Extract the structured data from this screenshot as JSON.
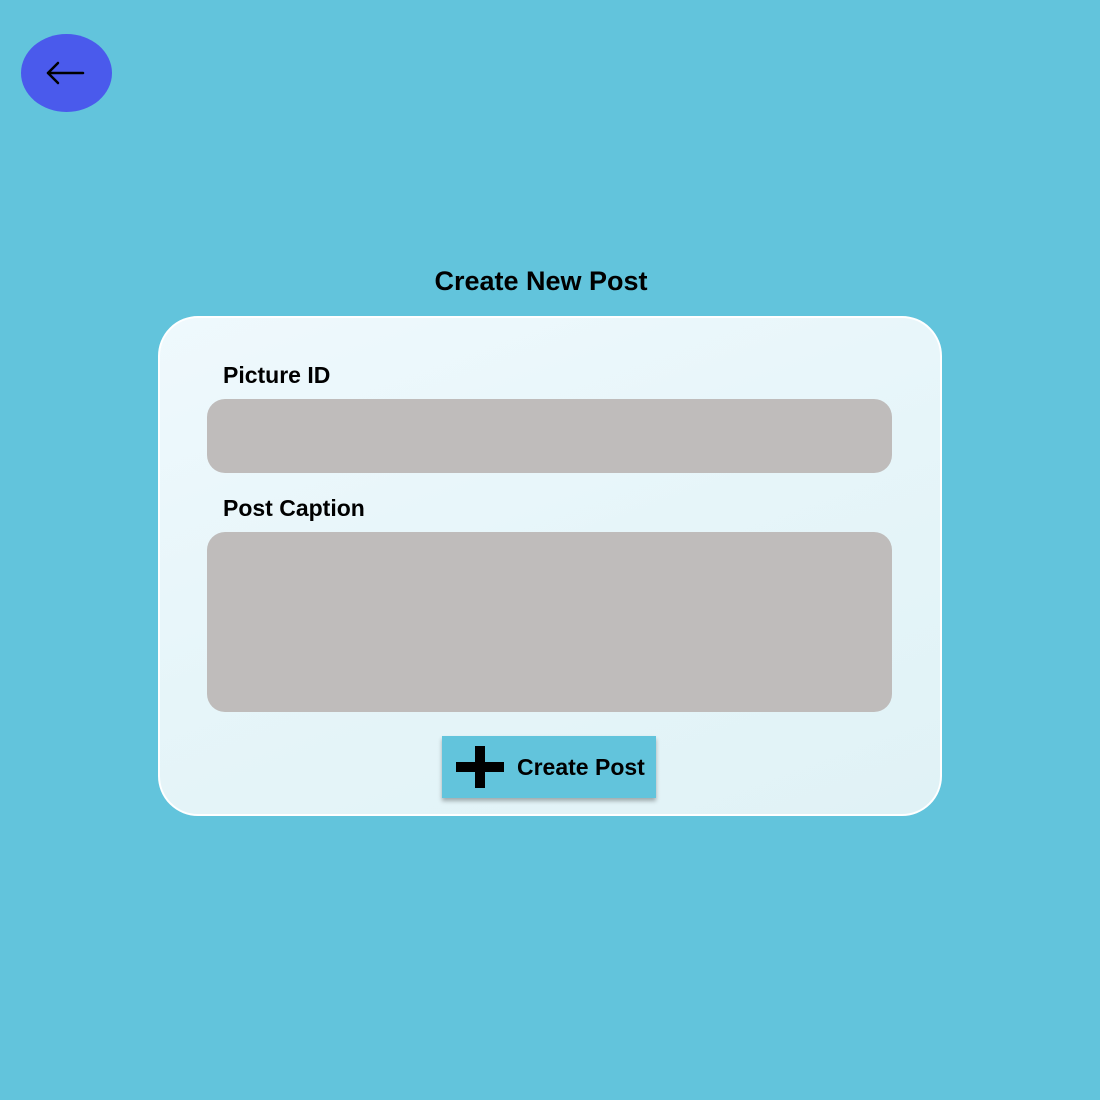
{
  "header": {
    "back_button": {
      "icon": "arrow-left-icon",
      "color": "#4a5aec"
    },
    "title": "Create New Post"
  },
  "form": {
    "picture_id": {
      "label": "Picture ID",
      "value": "",
      "placeholder": ""
    },
    "post_caption": {
      "label": "Post Caption",
      "value": "",
      "placeholder": ""
    },
    "submit_button": {
      "icon": "plus-icon",
      "label": "Create Post"
    }
  },
  "colors": {
    "background": "#62c4dc",
    "card": "#e6f5f9",
    "input": "#bfbcbb",
    "accent": "#4a5aec"
  }
}
